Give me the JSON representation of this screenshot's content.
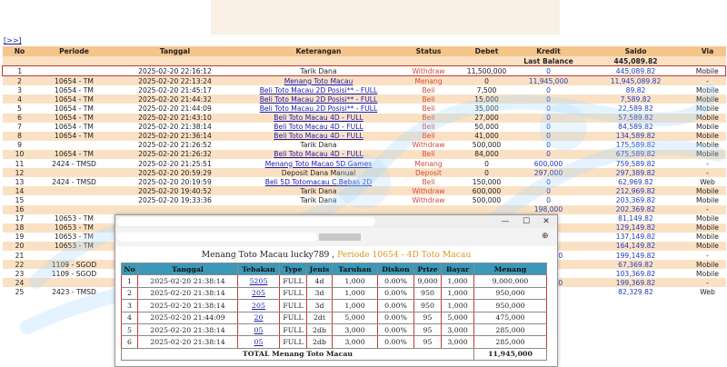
{
  "nav": {
    "back_label": "[>>]"
  },
  "headers": [
    "No",
    "Periode",
    "Tanggal",
    "Keterangan",
    "Status",
    "Debet",
    "Kredit",
    "Saldo",
    "Via"
  ],
  "last_balance": {
    "label": "Last Balance",
    "saldo": "445,089.82"
  },
  "rows": [
    {
      "no": "1",
      "periode": "",
      "tanggal": "2025-02-20 22:16:12",
      "ket": "Tarik Dana",
      "link": false,
      "status": "Withdraw",
      "debet": "11,500,000",
      "kredit": "0",
      "saldo": "445,089.82",
      "via": "Mobile"
    },
    {
      "no": "2",
      "periode": "10654 - TM",
      "tanggal": "2025-02-20 22:13:24",
      "ket": "Menang Toto Macau",
      "link": true,
      "status": "Menang",
      "debet": "0",
      "kredit": "11,945,000",
      "saldo": "11,945,089.82",
      "via": "-"
    },
    {
      "no": "3",
      "periode": "10654 - TM",
      "tanggal": "2025-02-20 21:45:17",
      "ket": "Beli Toto Macau 2D Posisi** - FULL",
      "link": true,
      "status": "Beli",
      "debet": "7,500",
      "kredit": "0",
      "saldo": "89.82",
      "via": "Mobile"
    },
    {
      "no": "4",
      "periode": "10654 - TM",
      "tanggal": "2025-02-20 21:44:32",
      "ket": "Beli Toto Macau 2D Posisi** - FULL",
      "link": true,
      "status": "Beli",
      "debet": "15,000",
      "kredit": "0",
      "saldo": "7,589.82",
      "via": "Mobile"
    },
    {
      "no": "5",
      "periode": "10654 - TM",
      "tanggal": "2025-02-20 21:44:09",
      "ket": "Beli Toto Macau 2D Posisi** - FULL",
      "link": true,
      "status": "Beli",
      "debet": "35,000",
      "kredit": "0",
      "saldo": "22,589.82",
      "via": "Mobile"
    },
    {
      "no": "6",
      "periode": "10654 - TM",
      "tanggal": "2025-02-20 21:43:10",
      "ket": "Beli Toto Macau 4D - FULL",
      "link": true,
      "status": "Beli",
      "debet": "27,000",
      "kredit": "0",
      "saldo": "57,589.82",
      "via": "Mobile"
    },
    {
      "no": "7",
      "periode": "10654 - TM",
      "tanggal": "2025-02-20 21:38:14",
      "ket": "Beli Toto Macau 4D - FULL",
      "link": true,
      "status": "Beli",
      "debet": "50,000",
      "kredit": "0",
      "saldo": "84,589.82",
      "via": "Mobile"
    },
    {
      "no": "8",
      "periode": "10654 - TM",
      "tanggal": "2025-02-20 21:36:14",
      "ket": "Beli Toto Macau 4D - FULL",
      "link": true,
      "status": "Beli",
      "debet": "41,000",
      "kredit": "0",
      "saldo": "134,589.82",
      "via": "Mobile"
    },
    {
      "no": "9",
      "periode": "",
      "tanggal": "2025-02-20 21:26:52",
      "ket": "Tarik Dana",
      "link": false,
      "status": "Withdraw",
      "debet": "500,000",
      "kredit": "0",
      "saldo": "175,589.82",
      "via": "Mobile"
    },
    {
      "no": "10",
      "periode": "10654 - TM",
      "tanggal": "2025-02-20 21:26:32",
      "ket": "Beli Toto Macau 4D - FULL",
      "link": true,
      "status": "Beli",
      "debet": "84,000",
      "kredit": "0",
      "saldo": "675,589.82",
      "via": "Mobile"
    },
    {
      "no": "11",
      "periode": "2424 - TMSD",
      "tanggal": "2025-02-20 21:25:51",
      "ket": "Menang Toto Macao 5D Games",
      "link": true,
      "status": "Menang",
      "debet": "0",
      "kredit": "600,000",
      "saldo": "759,589.82",
      "via": "-"
    },
    {
      "no": "12",
      "periode": "",
      "tanggal": "2025-02-20 20:59:29",
      "ket": "Deposit Dana Manual",
      "link": false,
      "status": "Deposit",
      "debet": "0",
      "kredit": "297,000",
      "saldo": "297,389.82",
      "via": "-"
    },
    {
      "no": "13",
      "periode": "2424 - TMSD",
      "tanggal": "2025-02-20 20:19:59",
      "ket": "Beli 5D Totomacau C.Bebas 2D",
      "link": true,
      "status": "Beli",
      "debet": "150,000",
      "kredit": "0",
      "saldo": "62,969.82",
      "via": "Web"
    },
    {
      "no": "14",
      "periode": "",
      "tanggal": "2025-02-20 19:40:52",
      "ket": "Tarik Dana",
      "link": false,
      "status": "Withdraw",
      "debet": "600,000",
      "kredit": "0",
      "saldo": "212,969.82",
      "via": "Mobile"
    },
    {
      "no": "15",
      "periode": "",
      "tanggal": "2025-02-20 19:33:36",
      "ket": "Tarik Dana",
      "link": false,
      "status": "Withdraw",
      "debet": "500,000",
      "kredit": "0",
      "saldo": "203,369.82",
      "via": "Mobile"
    },
    {
      "no": "16",
      "periode": "",
      "tanggal": "",
      "ket": "",
      "link": false,
      "status": "",
      "debet": "",
      "kredit": "198,000",
      "saldo": "202,369.82",
      "via": "-"
    },
    {
      "no": "17",
      "periode": "10653 - TM",
      "tanggal": "",
      "ket": "",
      "link": false,
      "status": "",
      "debet": "",
      "kredit": "0",
      "saldo": "81,149.82",
      "via": "Mobile"
    },
    {
      "no": "18",
      "periode": "10653 - TM",
      "tanggal": "",
      "ket": "",
      "link": false,
      "status": "",
      "debet": "",
      "kredit": "0",
      "saldo": "129,149.82",
      "via": "Mobile"
    },
    {
      "no": "19",
      "periode": "10653 - TM",
      "tanggal": "",
      "ket": "",
      "link": false,
      "status": "",
      "debet": "",
      "kredit": "0",
      "saldo": "137,149.82",
      "via": "Mobile"
    },
    {
      "no": "20",
      "periode": "10653 - TM",
      "tanggal": "",
      "ket": "",
      "link": false,
      "status": "",
      "debet": "",
      "kredit": "0",
      "saldo": "164,149.82",
      "via": "Mobile"
    },
    {
      "no": "21",
      "periode": "",
      "tanggal": "",
      "ket": "",
      "link": false,
      "status": "",
      "debet": "",
      "kredit": "199,000",
      "saldo": "199,149.82",
      "via": "-"
    },
    {
      "no": "22",
      "periode": "1109 - SGOD",
      "tanggal": "",
      "ket": "",
      "link": false,
      "status": "",
      "debet": "",
      "kredit": "0",
      "saldo": "67,369.82",
      "via": "Mobile"
    },
    {
      "no": "23",
      "periode": "1109 - SGOD",
      "tanggal": "",
      "ket": "",
      "link": false,
      "status": "",
      "debet": "",
      "kredit": "0",
      "saldo": "103,369.82",
      "via": "Mobile"
    },
    {
      "no": "24",
      "periode": "",
      "tanggal": "",
      "ket": "",
      "link": false,
      "status": "",
      "debet": "",
      "kredit": "198,000",
      "saldo": "199,369.82",
      "via": "-"
    },
    {
      "no": "25",
      "periode": "2423 - TMSD",
      "tanggal": "",
      "ket": "",
      "link": false,
      "status": "",
      "debet": "",
      "kredit": "0",
      "saldo": "82,329.82",
      "via": "Web"
    }
  ],
  "popup": {
    "heading_main": "Menang Toto Macau lucky789 , ",
    "heading_periode": "Periode 10654 - 4D Toto Macau",
    "headers": [
      "No",
      "Tanggal",
      "Tebakan",
      "Type",
      "Jenis",
      "Taruhan",
      "Diskon",
      "Prize",
      "Bayar",
      "Menang"
    ],
    "rows": [
      {
        "no": "1",
        "tanggal": "2025-02-20 21:38:14",
        "tebakan": "5205",
        "type": "FULL",
        "jenis": "4d",
        "taruhan": "1,000",
        "diskon": "0.00%",
        "prize": "9,000",
        "bayar": "1,000",
        "menang": "9,000,000"
      },
      {
        "no": "2",
        "tanggal": "2025-02-20 21:38:14",
        "tebakan": "205",
        "type": "FULL",
        "jenis": "3d",
        "taruhan": "1,000",
        "diskon": "0.00%",
        "prize": "950",
        "bayar": "1,000",
        "menang": "950,000"
      },
      {
        "no": "3",
        "tanggal": "2025-02-20 21:38:14",
        "tebakan": "205",
        "type": "FULL",
        "jenis": "3d",
        "taruhan": "1,000",
        "diskon": "0.00%",
        "prize": "950",
        "bayar": "1,000",
        "menang": "950,000"
      },
      {
        "no": "4",
        "tanggal": "2025-02-20 21:44:09",
        "tebakan": "20",
        "type": "FULL",
        "jenis": "2dt",
        "taruhan": "5,000",
        "diskon": "0.00%",
        "prize": "95",
        "bayar": "5,000",
        "menang": "475,000"
      },
      {
        "no": "5",
        "tanggal": "2025-02-20 21:38:14",
        "tebakan": "05",
        "type": "FULL",
        "jenis": "2db",
        "taruhan": "3,000",
        "diskon": "0.00%",
        "prize": "95",
        "bayar": "3,000",
        "menang": "285,000"
      },
      {
        "no": "6",
        "tanggal": "2025-02-20 21:38:14",
        "tebakan": "05",
        "type": "FULL",
        "jenis": "2db",
        "taruhan": "3,000",
        "diskon": "0.00%",
        "prize": "95",
        "bayar": "3,000",
        "menang": "285,000"
      }
    ],
    "total_label": "TOTAL  Menang Toto Macau",
    "total_value": "11,945,000",
    "window_buttons": {
      "minimize": "—",
      "maximize": "☐",
      "close": "✕",
      "zoom": "⊕"
    }
  },
  "colors": {
    "header": "#f5c58c",
    "alt_row": "#fbe1c4",
    "popup_header": "#3b98b8",
    "highlight": "#c0392b"
  }
}
